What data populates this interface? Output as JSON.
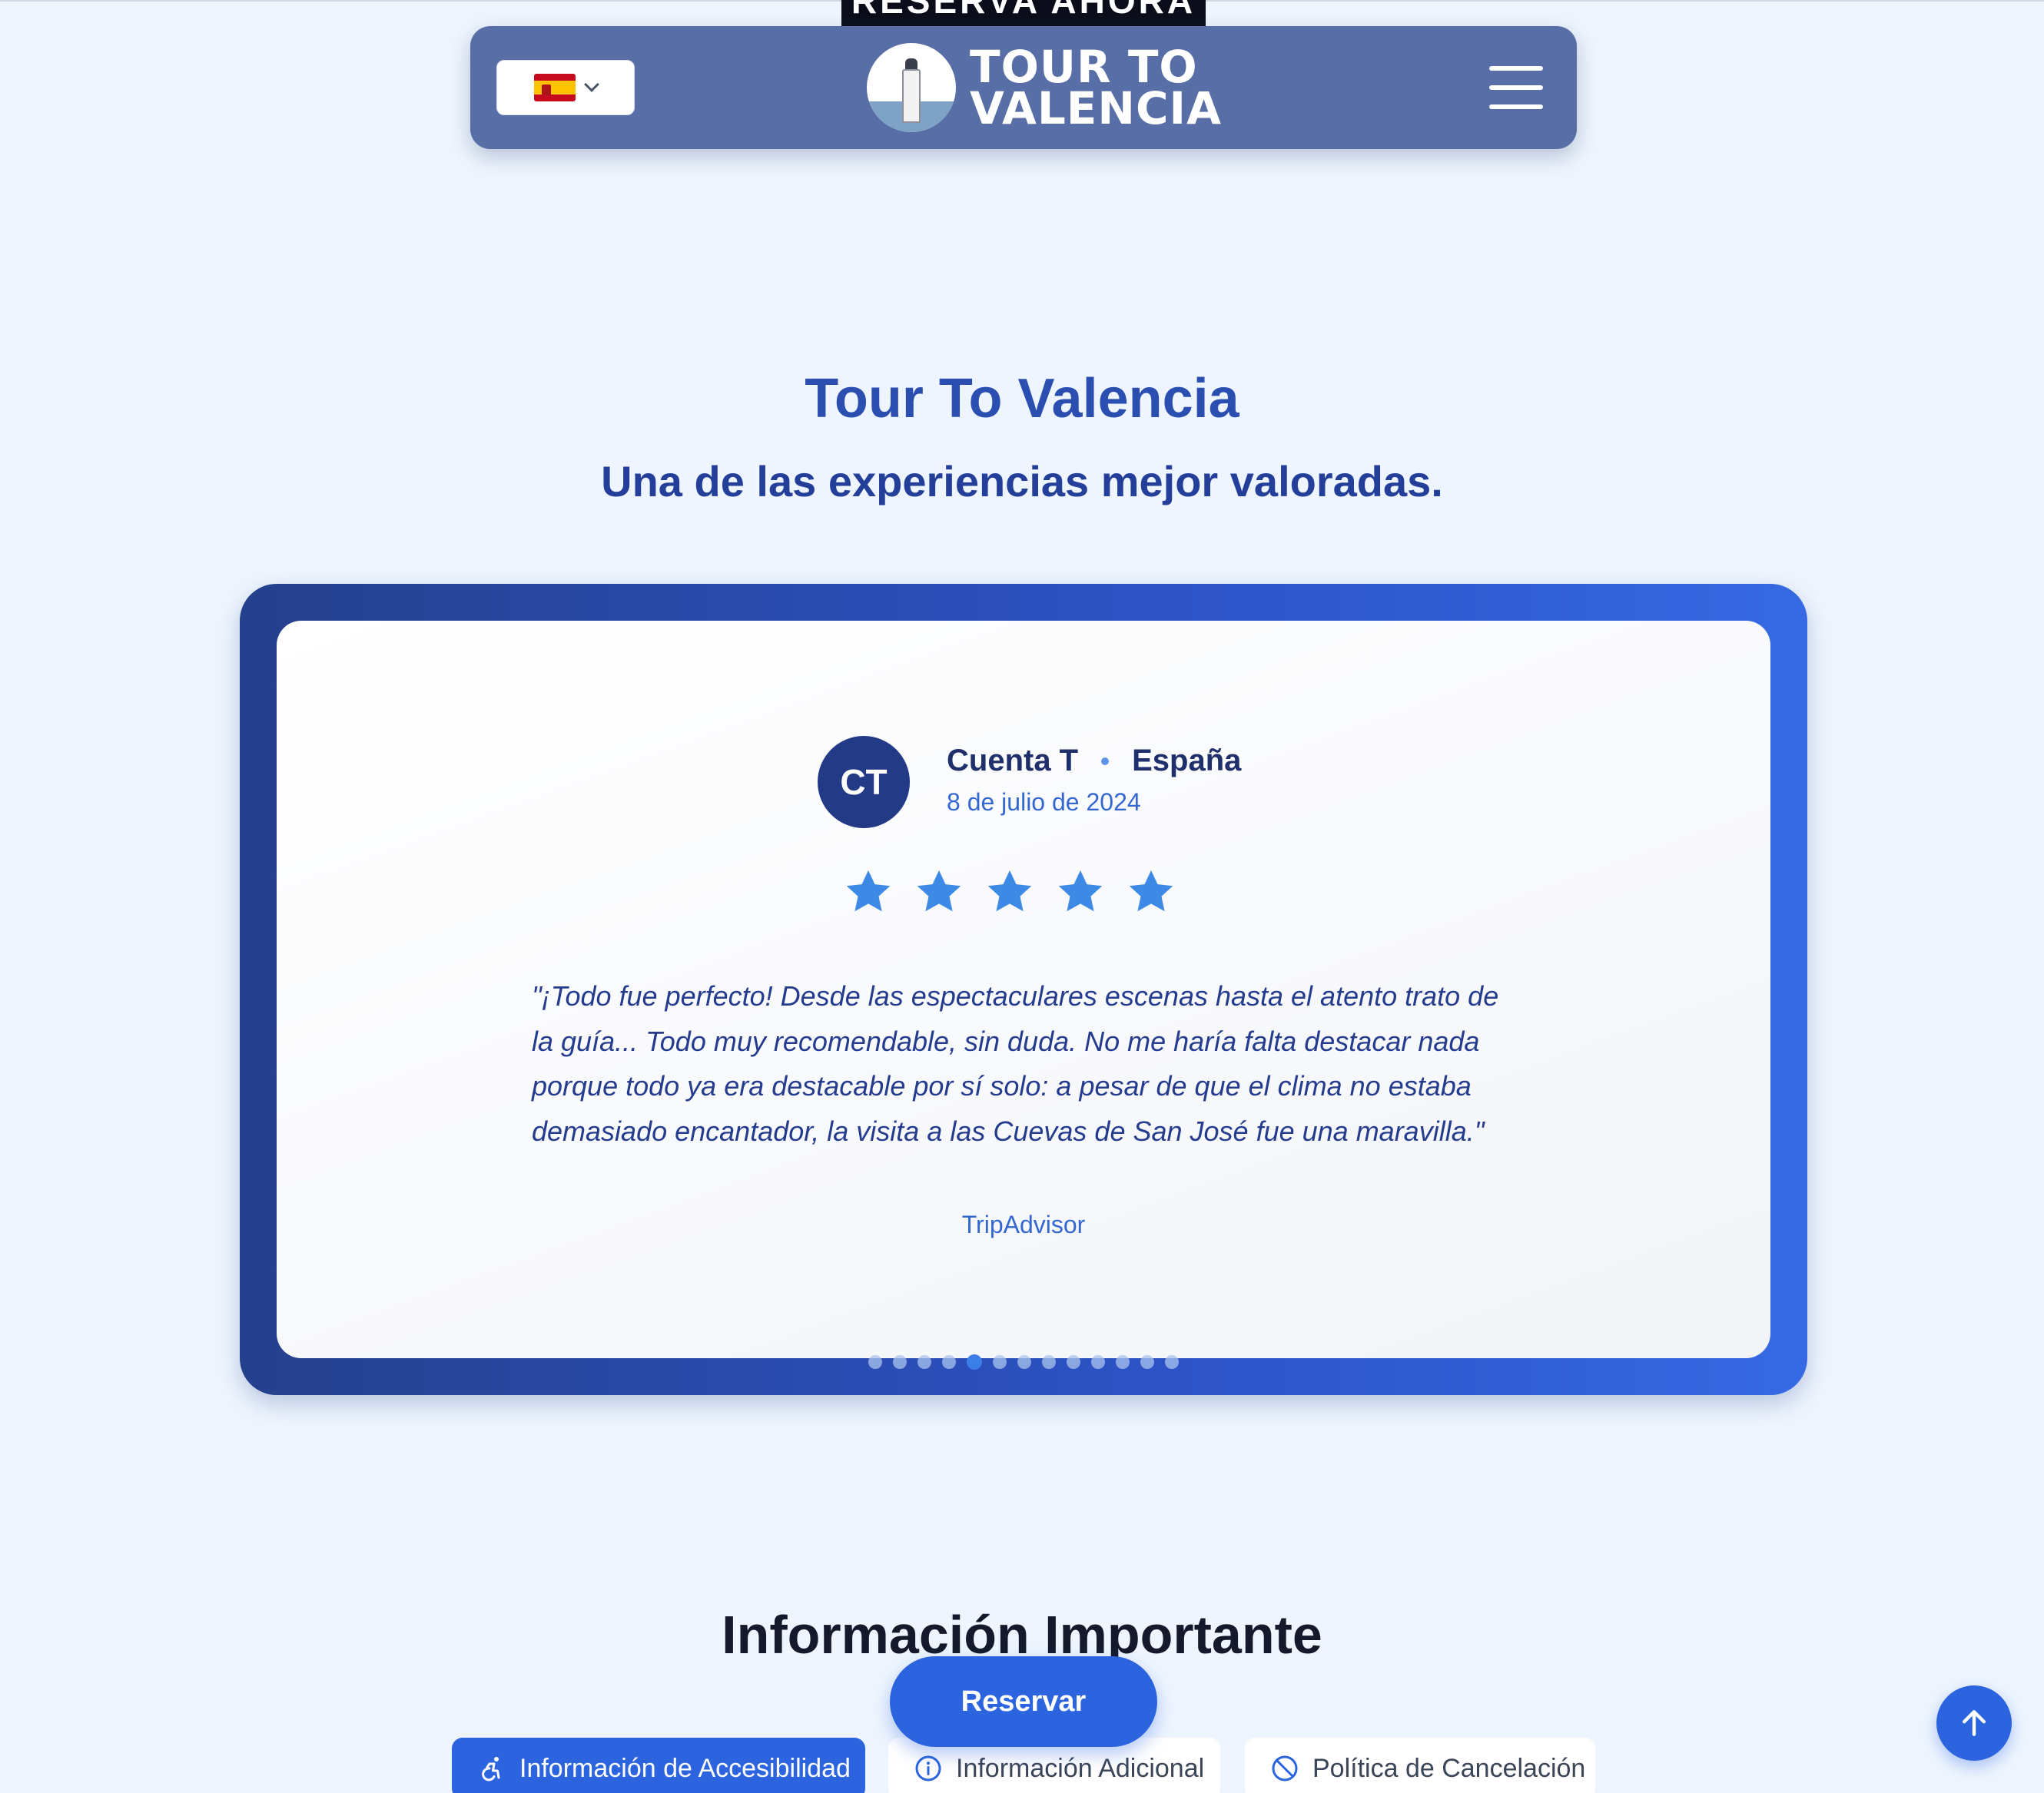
{
  "banner": {
    "label": "RESERVA AHORA"
  },
  "header": {
    "language": {
      "selected": "Español",
      "flag": "spain-flag-icon"
    },
    "logo": {
      "line1": "TOUR TO",
      "line2": "VALENCIA"
    },
    "menu_icon": "hamburger-menu-icon"
  },
  "hero": {
    "title": "Tour To Valencia",
    "subtitle": "Una de las experiencias mejor valoradas."
  },
  "review": {
    "initials": "CT",
    "name": "Cuenta T",
    "country": "España",
    "date": "8 de julio de 2024",
    "rating": 5,
    "max_rating": 5,
    "text": "\"¡Todo fue perfecto! Desde las espectaculares escenas hasta el atento trato de la guía... Todo muy recomendable, sin duda. No me haría falta destacar nada porque todo ya era destacable por sí solo: a pesar de que el clima no estaba demasiado encantador, la visita a las Cuevas de San José fue una maravilla.\"",
    "source": "TripAdvisor"
  },
  "carousel": {
    "total_slides": 13,
    "active_index": 4
  },
  "info": {
    "title": "Información Importante",
    "tabs": [
      {
        "label": "Información de Accesibilidad",
        "icon": "accessibility-icon",
        "active": true
      },
      {
        "label": "Información Adicional",
        "icon": "info-icon",
        "active": false
      },
      {
        "label": "Política de Cancelación",
        "icon": "cancel-icon",
        "active": false
      }
    ]
  },
  "cta": {
    "reserve_label": "Reservar"
  },
  "scroll_top_icon": "arrow-up-icon",
  "colors": {
    "background": "#eef5fe",
    "primary": "#2c64df",
    "header": "#586ea6",
    "title": "#2b4fb0",
    "star": "#3d8ae6"
  }
}
